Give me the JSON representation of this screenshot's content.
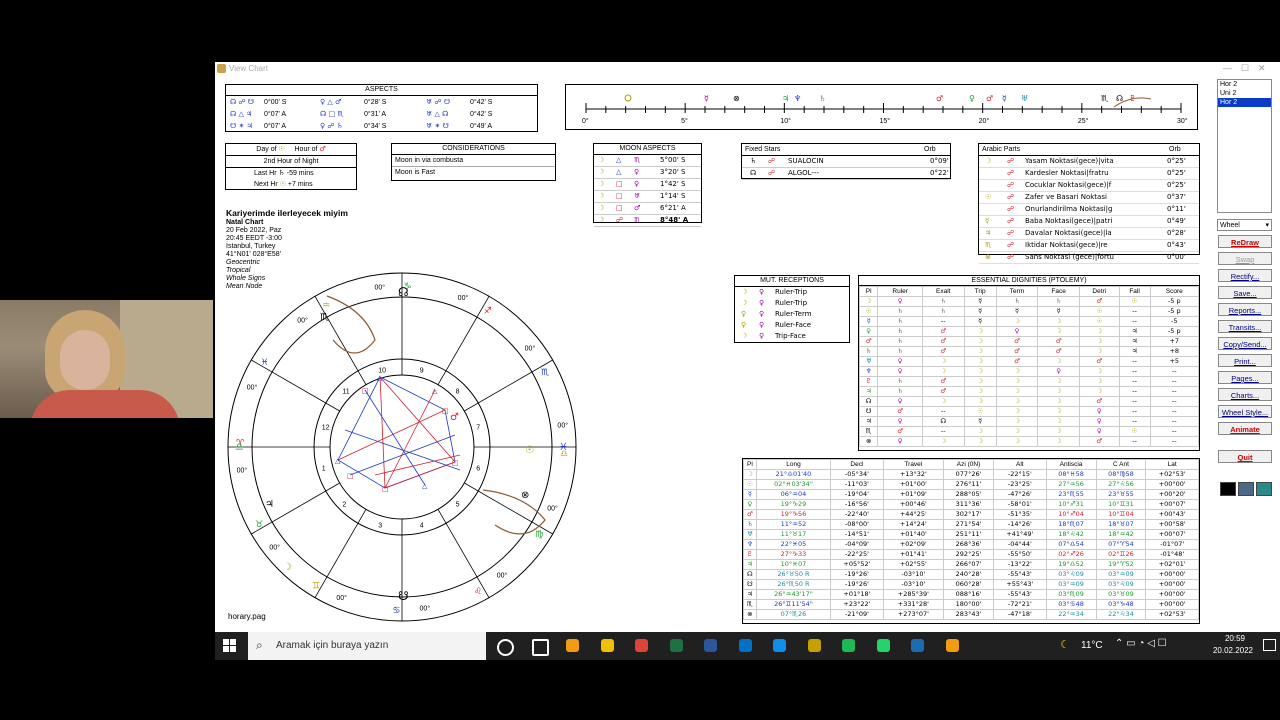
{
  "window": {
    "title": "View Chart",
    "controls": [
      "—",
      "☐",
      "✕"
    ]
  },
  "aspects_panel": {
    "title": "ASPECTS",
    "rows": [
      [
        "☊ ☍ ☋",
        "0°00' S",
        "♀ △ ♂",
        "0°28' S",
        "♅ ☍ ☋",
        "0°42' S"
      ],
      [
        "☊ △ ♃",
        "0°07' A",
        "☊ □ ♏",
        "0°31' A",
        "♅ △ ☊",
        "0°42' S"
      ],
      [
        "☋ ✶ ♃",
        "0°07' A",
        "♀ ☍ ♄",
        "0°34' S",
        "♅ ✶ ☋",
        "0°49' A"
      ]
    ]
  },
  "ruler": {
    "ticks": [
      "0°",
      "5°",
      "10°",
      "15°",
      "20°",
      "25°",
      "30°"
    ]
  },
  "day_hour": {
    "day_label": "Day of",
    "hour_label": "Hour of",
    "hour_line": "2nd Hour of Night",
    "last_label": "Last Hr",
    "last_value": "-59 mins",
    "next_label": "Next Hr",
    "next_value": "+7 mins"
  },
  "considerations": {
    "title": "CONSIDERATIONS",
    "lines": [
      "Moon in via combusta",
      "Moon is Fast"
    ]
  },
  "moon_aspects": {
    "title": "MOON ASPECTS",
    "rows": [
      [
        "☽",
        "△",
        "♏",
        "5°00' S"
      ],
      [
        "☽",
        "△",
        "♀",
        "3°20' S"
      ],
      [
        "☽",
        "□",
        "♀",
        "1°42' S"
      ],
      [
        "☽",
        "□",
        "♅",
        "1°14' S"
      ],
      [
        "☽",
        "□",
        "♂",
        "6°21' A"
      ],
      [
        "☽",
        "☍",
        "♏",
        "8°48' A"
      ]
    ]
  },
  "fixed_stars": {
    "title": "Fixed Stars",
    "orb_label": "Orb",
    "rows": [
      [
        "♄",
        "☍",
        "SUALOCIN",
        "0°09'"
      ],
      [
        "☊",
        "☍",
        "ALGOL---",
        "0°22'"
      ]
    ]
  },
  "arabic_parts": {
    "title": "Arabic Parts",
    "orb_label": "Orb",
    "rows": [
      [
        "☽",
        "☍",
        "Yasam Noktasi(gece)|vita",
        "0°25'"
      ],
      [
        "",
        "☍",
        "Kardesler Noktasi|fratru",
        "0°25'"
      ],
      [
        "",
        "☍",
        "Cocuklar Noktasi(gece)|f",
        "0°25'"
      ],
      [
        "☉",
        "☍",
        "Zafer ve Basari Noktasi",
        "0°37'"
      ],
      [
        "",
        "☍",
        "Onurlandirilma Noktasi|g",
        "0°11'"
      ],
      [
        "☿",
        "☍",
        "Baba Noktasi(gece)|patri",
        "0°49'"
      ],
      [
        "♃",
        "☍",
        "Davalar Noktasi(gece)|la",
        "0°28'"
      ],
      [
        "♏",
        "☍",
        "Iktidar Noktasi(gece)|re",
        "0°43'"
      ],
      [
        "⊗",
        "☍",
        "Sans Noktasi (gece)|fortu",
        "0°00'"
      ]
    ]
  },
  "chart_info": {
    "title": "Kariyerimde ilerleyecek miyim",
    "subtitle": "Natal Chart",
    "date": "20 Feb 2022, Paz",
    "time": "20:45  EEDT  -3:00",
    "place": "İstanbul, Turkey",
    "coords": "41°N01' 028°E58'",
    "options": [
      "Geocentric",
      "Tropical",
      "Whole Signs",
      "Mean Node"
    ],
    "footer": "horary.pag"
  },
  "wheel": {
    "house_numbers": [
      "1",
      "2",
      "3",
      "4",
      "5",
      "6",
      "7",
      "8",
      "9",
      "10",
      "11",
      "12"
    ],
    "degrees": [
      "00°",
      "00°",
      "00°",
      "00°",
      "00°",
      "00°",
      "00°",
      "00°",
      "00°",
      "00°",
      "00°",
      "00°"
    ],
    "signs": [
      "♈",
      "♉",
      "♊",
      "♋",
      "♌",
      "♍",
      "♎",
      "♏",
      "♐",
      "♑",
      "♒",
      "♓"
    ]
  },
  "mut_receptions": {
    "title": "MUT. RECEPTIONS",
    "rows": [
      [
        "☽",
        "♀",
        "Ruler-Trip"
      ],
      [
        "☽",
        "♀",
        "Ruler-Trip"
      ],
      [
        "♀",
        "♀",
        "Ruler-Term"
      ],
      [
        "♀",
        "♀",
        "Ruler-Face"
      ],
      [
        "☽",
        "♀",
        "Trip-Face"
      ]
    ]
  },
  "dignities": {
    "title": "ESSENTIAL DIGNITIES (PTOLEMY)",
    "headers": [
      "Pl",
      "Ruler",
      "Exalt",
      "Trip",
      "Term",
      "Face",
      "Detri",
      "Fall",
      "Score"
    ],
    "rows": [
      [
        "☽",
        "♀",
        "♄",
        "☿",
        "♄",
        "♄",
        "♂",
        "☉",
        "-5 p"
      ],
      [
        "☉",
        "♄",
        "♄",
        "☿",
        "☿",
        "☿",
        "☉",
        "--",
        "-5 p"
      ],
      [
        "☿",
        "♄",
        "--",
        "☿",
        "☽",
        "☽",
        "☉",
        "--",
        "-5"
      ],
      [
        "♀",
        "♄",
        "♂",
        "☽",
        "♀",
        "☽",
        "☽",
        "♃",
        "-5 p"
      ],
      [
        "♂",
        "♄",
        "♂",
        "☽",
        "♂",
        "♂",
        "☽",
        "♃",
        "+7"
      ],
      [
        "♄",
        "♄",
        "♂",
        "☽",
        "♂",
        "♂",
        "☽",
        "♃",
        "+8"
      ],
      [
        "♅",
        "♀",
        "☽",
        "☽",
        "♂",
        "☽",
        "♂",
        "--",
        "+5"
      ],
      [
        "♆",
        "♀",
        "☽",
        "☽",
        "☽",
        "♀",
        "☽",
        "--",
        "--"
      ],
      [
        "♇",
        "♄",
        "♂",
        "☽",
        "☽",
        "☽",
        "☽",
        "--",
        "--"
      ],
      [
        "♃",
        "♄",
        "♂",
        "☽",
        "☽",
        "☽",
        "☽",
        "--",
        "--"
      ],
      [
        "☊",
        "♀",
        "☽",
        "☽",
        "☽",
        "☽",
        "♂",
        "--",
        "--"
      ],
      [
        "☋",
        "♂",
        "--",
        "☉",
        "☽",
        "☽",
        "♀",
        "--",
        "--"
      ],
      [
        "♃",
        "♀",
        "☊",
        "☿",
        "☽",
        "☽",
        "♀",
        "--",
        "--"
      ],
      [
        "♏",
        "♂",
        "--",
        "☽",
        "☽",
        "☽",
        "♀",
        "☉",
        "--"
      ],
      [
        "⊗",
        "♀",
        "☽",
        "☽",
        "☽",
        "☽",
        "♂",
        "--",
        "--"
      ]
    ]
  },
  "positions": {
    "headers": [
      "Pl",
      "Long",
      "Decl",
      "Travel",
      "Azi (0N)",
      "Alt",
      "Antiscia",
      "C Ant",
      "Lat"
    ],
    "rows": [
      [
        "☽",
        "21°♎01'40",
        "-05°34'",
        "+13°32'",
        "077°26'",
        "-22°15'",
        "08°♓58",
        "08°♍58",
        "+02°53'"
      ],
      [
        "☉",
        "02°♓03'34\"",
        "-11°03'",
        "+01°00'",
        "276°11'",
        "-23°25'",
        "27°♒56",
        "27°♌56",
        "+00°00'"
      ],
      [
        "☿",
        "06°♒04",
        "-19°04'",
        "+01°09'",
        "288°05'",
        "-47°26'",
        "23°♏55",
        "23°♉55",
        "+00°20'"
      ],
      [
        "♀",
        "19°♑29",
        "-16°56'",
        "+00°46'",
        "311°36'",
        "-58°01'",
        "10°♐31",
        "10°♊31",
        "+00°07'"
      ],
      [
        "♂",
        "19°♑56",
        "-22°40'",
        "+44°25'",
        "302°17'",
        "-51°35'",
        "10°♐04",
        "10°♊04",
        "+00°43'"
      ],
      [
        "♄",
        "11°♒52",
        "-08°00'",
        "+14°24'",
        "271°54'",
        "-14°26'",
        "18°♏07",
        "18°♉07",
        "+00°58'"
      ],
      [
        "♅",
        "11°♉17",
        "-14°51'",
        "+01°40'",
        "251°11'",
        "+41°49'",
        "18°♌42",
        "18°♒42",
        "+00°07'"
      ],
      [
        "♆",
        "22°♓05",
        "-04°09'",
        "+02°09'",
        "268°36'",
        "-04°44'",
        "07°♎54",
        "07°♈54",
        "-01°07'"
      ],
      [
        "♇",
        "27°♑33",
        "-22°25'",
        "+01°41'",
        "292°25'",
        "-55°50'",
        "02°♐26",
        "02°♊26",
        "-01°48'"
      ],
      [
        "♃",
        "10°♓07",
        "+05°52'",
        "+02°55'",
        "266°07'",
        "-13°22'",
        "19°♎52",
        "19°♈52",
        "+02°01'"
      ],
      [
        "☊",
        "26°♉50 R",
        "-19°26'",
        "-03°10'",
        "240°28'",
        "-55°43'",
        "03°♌09",
        "03°♒09",
        "+00°00'"
      ],
      [
        "☋",
        "26°♏50 R",
        "-19°26'",
        "-03°10'",
        "060°28'",
        "+55°43'",
        "03°♒09",
        "03°♌09",
        "+00°00'"
      ],
      [
        "♃",
        "26°♒43'17\"",
        "+01°18'",
        "+285°39'",
        "088°16'",
        "-55°43'",
        "03°♏09",
        "03°♉09",
        "+00°00'"
      ],
      [
        "♏",
        "26°♊11'54\"",
        "+23°22'",
        "+331°28'",
        "180°00'",
        "-72°21'",
        "03°♋48",
        "03°♑48",
        "+00°00'"
      ],
      [
        "⊗",
        "07°♏26",
        "-21°09'",
        "+273°07'",
        "283°43'",
        "-47°18'",
        "22°♒34",
        "22°♌34",
        "+02°53'"
      ]
    ]
  },
  "list_panel": {
    "items": [
      "Hor 2",
      "Uni 2",
      "Hor 2"
    ],
    "selected": 2
  },
  "style_select": {
    "value": "Wheel"
  },
  "buttons": [
    "ReDraw",
    "Swap",
    "Rectify...",
    "Save...",
    "Reports...",
    "Transits...",
    "Copy/Send...",
    "Print...",
    "Pages...",
    "Charts...",
    "Wheel Style...",
    "Animate",
    "Quit"
  ],
  "taskbar": {
    "search_placeholder": "Aramak için buraya yazın",
    "weather": "11°C",
    "time": "20:59",
    "date": "20.02.2022",
    "apps": [
      "cortana",
      "task-view",
      "app-orange",
      "file-explorer",
      "chrome",
      "excel",
      "word",
      "outlook",
      "teamviewer",
      "app-yellow",
      "spotify",
      "whatsapp",
      "app-blue",
      "app-orange-2"
    ]
  },
  "colors": {
    "red": "#d0202a",
    "blue": "#1c38c8",
    "green": "#1a9a2a",
    "brown": "#8a5a30",
    "selection": "#0a3cc8"
  }
}
